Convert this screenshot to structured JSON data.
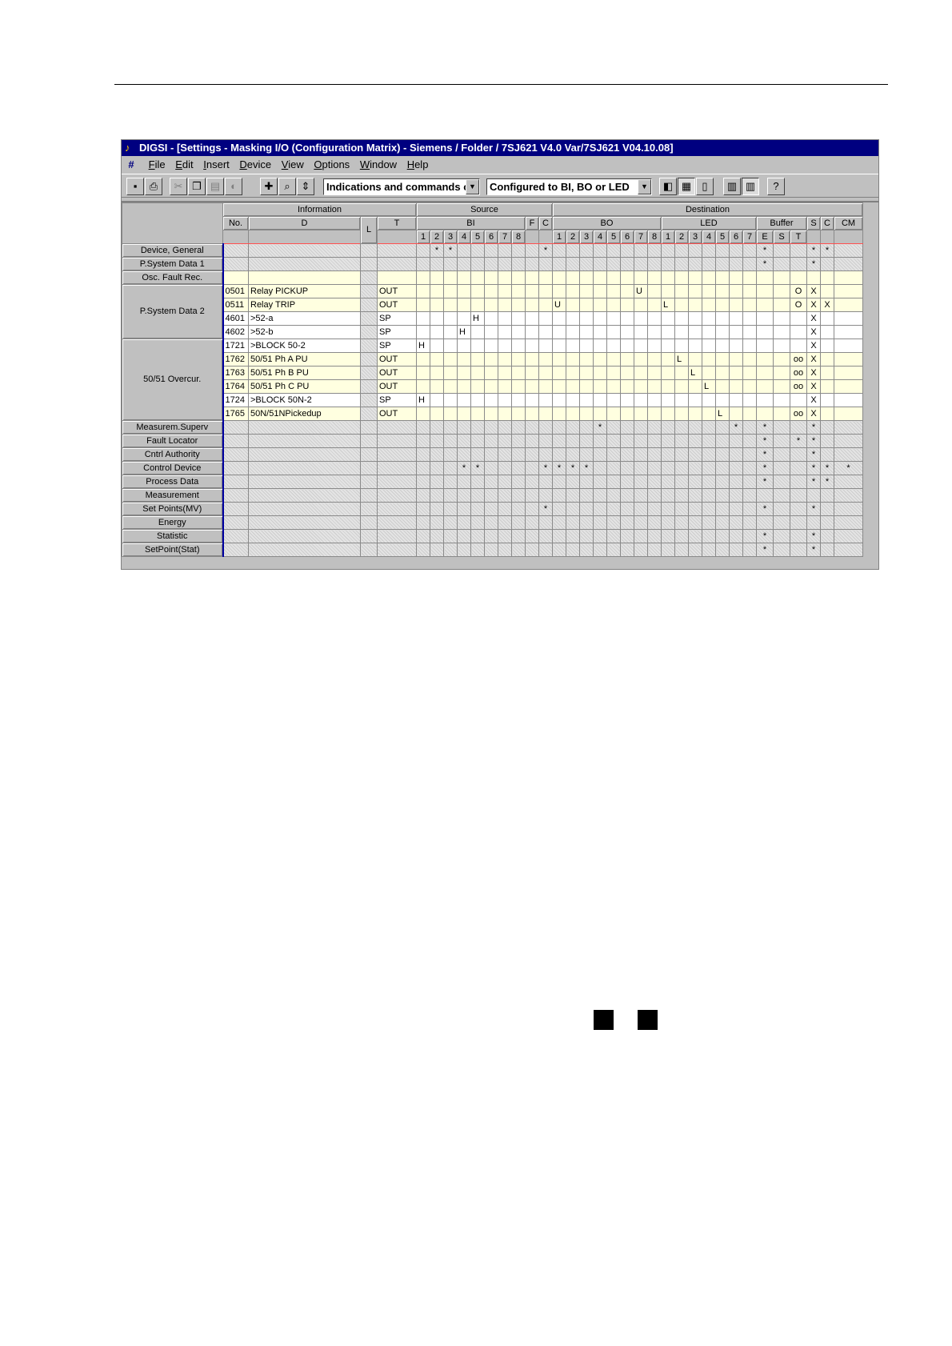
{
  "window": {
    "title": "DIGSI - [Settings - Masking I/O (Configuration Matrix) - Siemens / Folder / 7SJ621 V4.0 Var/7SJ621 V04.10.08]"
  },
  "menu": [
    "File",
    "Edit",
    "Insert",
    "Device",
    "View",
    "Options",
    "Window",
    "Help"
  ],
  "toolbar": {
    "filter_combo": "Indications and commands o",
    "config_combo": "Configured to BI, BO or LED"
  },
  "header": {
    "information": "Information",
    "source": "Source",
    "destination": "Destination",
    "no": "No.",
    "d": "D",
    "l": "L",
    "t": "T",
    "bi": "BI",
    "f": "F",
    "c_src": "C",
    "bo": "BO",
    "led": "LED",
    "buffer": "Buffer",
    "s": "S",
    "c_dst": "C",
    "cm": "CM",
    "bi_cols": [
      "1",
      "2",
      "3",
      "4",
      "5",
      "6",
      "7",
      "8"
    ],
    "bo_cols": [
      "1",
      "2",
      "3",
      "4",
      "5",
      "6",
      "7",
      "8"
    ],
    "led_cols": [
      "1",
      "2",
      "3",
      "4",
      "5",
      "6",
      "7"
    ],
    "buffer_cols": [
      "E",
      "S",
      "T"
    ]
  },
  "groups": [
    {
      "label": "Device, General"
    },
    {
      "label": "P.System Data 1"
    },
    {
      "label": "Osc. Fault Rec."
    },
    {
      "label": "P.System Data 2"
    },
    {
      "label": "50/51 Overcur."
    },
    {
      "label": "Measurem.Superv"
    },
    {
      "label": "Fault Locator"
    },
    {
      "label": "Cntrl Authority"
    },
    {
      "label": "Control Device"
    },
    {
      "label": "Process Data"
    },
    {
      "label": "Measurement"
    },
    {
      "label": "Set Points(MV)"
    },
    {
      "label": "Energy"
    },
    {
      "label": "Statistic"
    },
    {
      "label": "SetPoint(Stat)"
    }
  ],
  "rows": [
    {
      "no": "0501",
      "d": "Relay PICKUP",
      "t": "OUT"
    },
    {
      "no": "0511",
      "d": "Relay TRIP",
      "t": "OUT"
    },
    {
      "no": "4601",
      "d": ">52-a",
      "t": "SP"
    },
    {
      "no": "4602",
      "d": ">52-b",
      "t": "SP"
    },
    {
      "no": "1721",
      "d": ">BLOCK 50-2",
      "t": "SP"
    },
    {
      "no": "1762",
      "d": "50/51 Ph A PU",
      "t": "OUT"
    },
    {
      "no": "1763",
      "d": "50/51 Ph B PU",
      "t": "OUT"
    },
    {
      "no": "1764",
      "d": "50/51 Ph C PU",
      "t": "OUT"
    },
    {
      "no": "1724",
      "d": ">BLOCK 50N-2",
      "t": "SP"
    },
    {
      "no": "1765",
      "d": "50N/51NPickedup",
      "t": "OUT"
    }
  ],
  "marks": {
    "star": "*",
    "h": "H",
    "u": "U",
    "l": "L",
    "o": "O",
    "oo": "oo",
    "x": "X"
  }
}
